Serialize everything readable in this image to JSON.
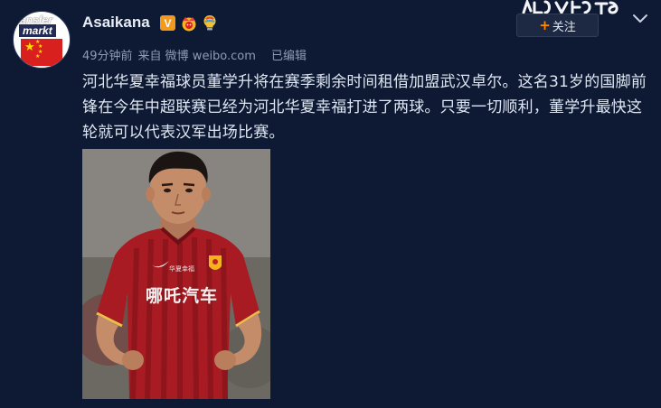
{
  "post": {
    "avatar": {
      "logo_line1": "ansfer",
      "logo_line2": "markt"
    },
    "username": "Asaikana",
    "badges": {
      "verified_label": "V",
      "icons": [
        "verified-v-icon",
        "crown-icon",
        "lightbulb-icon"
      ]
    },
    "meta": {
      "time": "49分钟前",
      "source": "来自 微博 weibo.com",
      "edited": "已编辑"
    },
    "follow_button": {
      "plus": "+",
      "label": "关注"
    },
    "text": "河北华夏幸福球员董学升将在赛季剩余时间租借加盟武汉卓尔。这名31岁的国脚前锋在今年中超联赛已经为河北华夏幸福打进了两球。只要一切顺利，董学升最快这轮就可以代表汉军出场比赛。",
    "photo": {
      "jersey_text": "哪吒汽车",
      "sponsor_mark": "华夏幸福"
    }
  },
  "colors": {
    "background": "#0e1a33",
    "text": "#dfe6f3",
    "meta": "#8f9bb3",
    "accent_orange": "#ff8a00",
    "jersey_red": "#a81b22"
  }
}
